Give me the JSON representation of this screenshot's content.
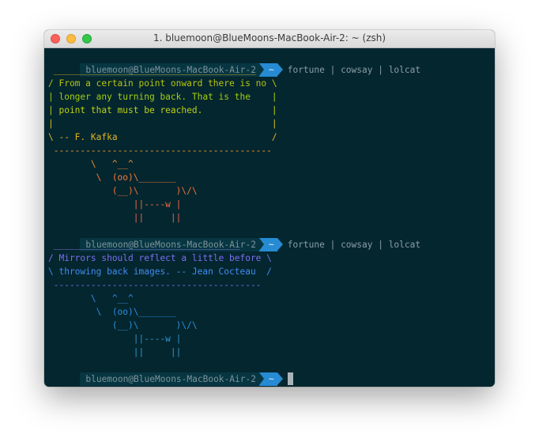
{
  "window": {
    "title": "1. bluemoon@BlueMoons-MacBook-Air-2: ~ (zsh)"
  },
  "prompt": {
    "user": "bluemoon@BlueMoons-MacBook-Air-2",
    "dir": "~"
  },
  "block1": {
    "command": "fortune | cowsay | lolcat",
    "lines": [
      " ______________________________________",
      "/ From a certain point onward there is no \\",
      "| longer any turning back. That is the    |",
      "| point that must be reached.             |",
      "|                                         |",
      "\\ -- F. Kafka                             /",
      " -----------------------------------------",
      "        \\   ^__^",
      "         \\  (oo)\\_______",
      "            (__)\\       )\\/\\",
      "                ||----w |",
      "                ||     ||"
    ],
    "colors": [
      "#d4a514",
      "#b5c510",
      "#a3cf12",
      "#bcd114",
      "#d8c61a",
      "#e3b51c",
      "#f09a2c",
      "#f28a32",
      "#f47c3a",
      "#f57032",
      "#f26a3e",
      "#ee6348"
    ]
  },
  "block2": {
    "command": "fortune | cowsay | lolcat",
    "lines": [
      " ___________________________________",
      "/ Mirrors should reflect a little before \\",
      "\\ throwing back images. -- Jean Cocteau  /",
      " ---------------------------------------",
      "        \\   ^__^",
      "         \\  (oo)\\_______",
      "            (__)\\       )\\/\\",
      "                ||----w |",
      "                ||     ||"
    ],
    "colors": [
      "#8a74e6",
      "#7b6ff0",
      "#3f8cf0",
      "#6a6ef0",
      "#2f8be8",
      "#2b8ee0",
      "#2c8fda",
      "#2b96d4",
      "#2a9ccc"
    ]
  }
}
